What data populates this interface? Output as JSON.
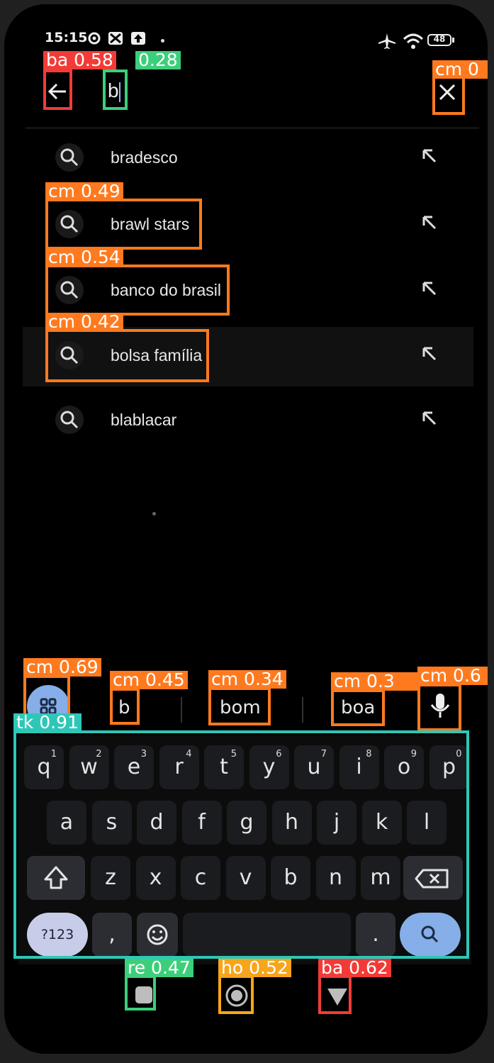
{
  "status_bar": {
    "time": "15:15",
    "battery": "48"
  },
  "search": {
    "query": "b"
  },
  "suggestions": [
    {
      "text": "bradesco"
    },
    {
      "text": "brawl stars"
    },
    {
      "text": "banco do brasil"
    },
    {
      "text": "bolsa família"
    },
    {
      "text": "blablacar"
    }
  ],
  "keyboard": {
    "word_suggestions": [
      "b",
      "bom",
      "boa"
    ],
    "row1": [
      {
        "k": "q",
        "n": "1"
      },
      {
        "k": "w",
        "n": "2"
      },
      {
        "k": "e",
        "n": "3"
      },
      {
        "k": "r",
        "n": "4"
      },
      {
        "k": "t",
        "n": "5"
      },
      {
        "k": "y",
        "n": "6"
      },
      {
        "k": "u",
        "n": "7"
      },
      {
        "k": "i",
        "n": "8"
      },
      {
        "k": "o",
        "n": "9"
      },
      {
        "k": "p",
        "n": "0"
      }
    ],
    "row2": [
      "a",
      "s",
      "d",
      "f",
      "g",
      "h",
      "j",
      "k",
      "l"
    ],
    "row3": [
      "z",
      "x",
      "c",
      "v",
      "b",
      "n",
      "m"
    ],
    "symbols_key": "?123",
    "comma_key": ",",
    "period_key": "."
  },
  "detections": [
    {
      "label": "ba 0.58",
      "color": "#f23b37"
    },
    {
      "label": "0.28",
      "color": "#3ccf7a"
    },
    {
      "label": "cm 0",
      "color": "#ff7a1f"
    },
    {
      "label": "cm 0.49",
      "color": "#ff7a1f"
    },
    {
      "label": "cm 0.54",
      "color": "#ff7a1f"
    },
    {
      "label": "cm 0.42",
      "color": "#ff7a1f"
    },
    {
      "label": "cm 0.69",
      "color": "#ff7a1f"
    },
    {
      "label": "cm 0.45",
      "color": "#ff7a1f"
    },
    {
      "label": "cm 0.34",
      "color": "#ff7a1f"
    },
    {
      "label": "cm 0.3",
      "color": "#ff7a1f"
    },
    {
      "label": "cm 0.6",
      "color": "#ff7a1f"
    },
    {
      "label": "tk 0.91",
      "color": "#2ec7b7"
    },
    {
      "label": "re 0.47",
      "color": "#3ccf7a"
    },
    {
      "label": "ho 0.52",
      "color": "#f7a51a"
    },
    {
      "label": "ba 0.62",
      "color": "#f23b37"
    }
  ]
}
